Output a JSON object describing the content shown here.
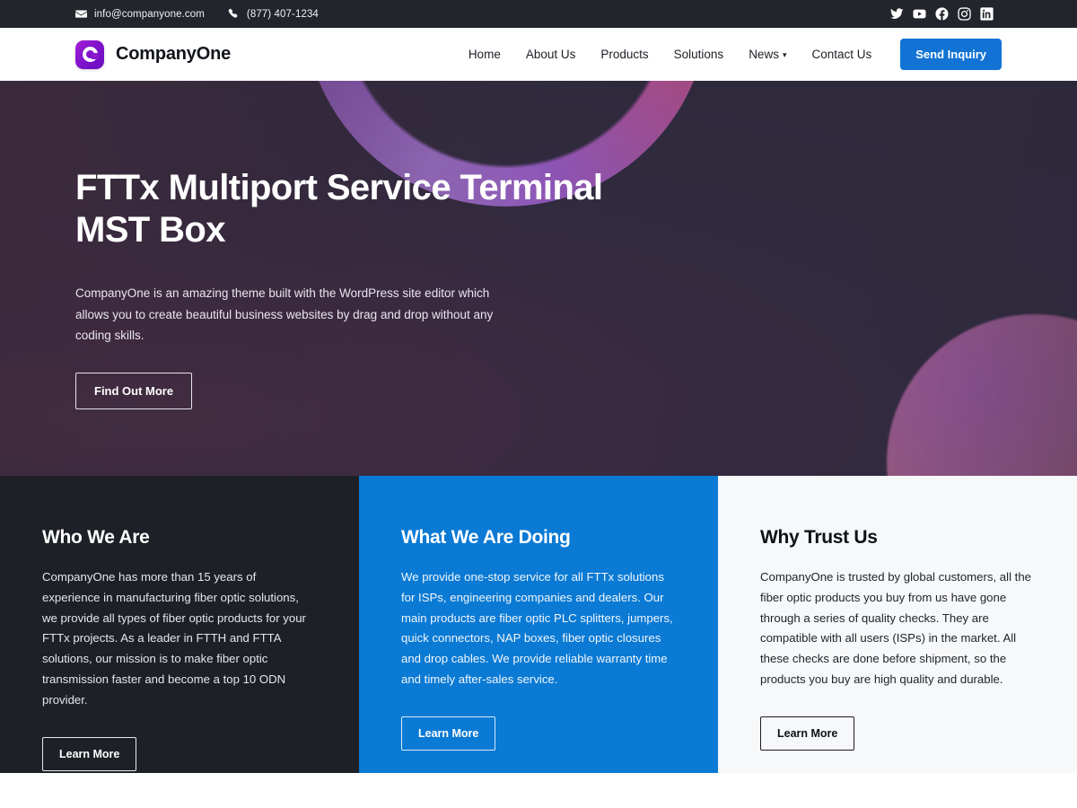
{
  "topbar": {
    "email": "info@companyone.com",
    "phone": "(877) 407-1234",
    "email_icon": "envelope-icon",
    "phone_icon": "phone-icon",
    "socials": [
      {
        "name": "twitter-icon",
        "label": "Twitter"
      },
      {
        "name": "youtube-icon",
        "label": "YouTube"
      },
      {
        "name": "facebook-icon",
        "label": "Facebook"
      },
      {
        "name": "instagram-icon",
        "label": "Instagram"
      },
      {
        "name": "linkedin-icon",
        "label": "LinkedIn"
      }
    ],
    "background": "#22252c"
  },
  "header": {
    "brand": "CompanyOne",
    "logo_icon": "companyone-logo-icon",
    "nav": [
      {
        "label": "Home",
        "has_dropdown": false
      },
      {
        "label": "About Us",
        "has_dropdown": false
      },
      {
        "label": "Products",
        "has_dropdown": false
      },
      {
        "label": "Solutions",
        "has_dropdown": false
      },
      {
        "label": "News",
        "has_dropdown": true
      },
      {
        "label": "Contact Us",
        "has_dropdown": false
      }
    ],
    "cta_label": "Send Inquiry",
    "cta_color": "#1273d4"
  },
  "hero": {
    "title": "FTTx Multiport Service Terminal MST Box",
    "description": "CompanyOne is an amazing theme built with the WordPress site editor which allows you to create beautiful business websites by drag and drop without any coding skills.",
    "button_label": "Find Out More",
    "background_colors": [
      "#3d2b42",
      "#2e2a3c",
      "#e08a4c",
      "#a468d8",
      "#c96fae"
    ]
  },
  "columns": [
    {
      "title": "Who We Are",
      "text": "CompanyOne has more than 15 years of experience in manufacturing fiber optic solutions, we provide all types of fiber optic products for your FTTx projects. As a leader in FTTH and FTTA solutions, our mission is to make fiber optic transmission faster and become a top 10 ODN provider.",
      "button_label": "Learn More",
      "background": "#1d2026"
    },
    {
      "title": "What We Are Doing",
      "text": "We provide one-stop service for all FTTx solutions for ISPs, engineering companies and dealers. Our main products are fiber optic PLC splitters, jumpers, quick connectors, NAP boxes, fiber optic closures and drop cables. We provide reliable warranty time and timely after-sales service.",
      "button_label": "Learn More",
      "background": "#0a7ad4"
    },
    {
      "title": "Why Trust Us",
      "text": "CompanyOne is trusted by global customers, all the fiber optic products you buy from us have gone through a series of quality checks. They are compatible with all users (ISPs) in the market. All these checks are done before shipment, so the products you buy are high quality and durable.",
      "button_label": "Learn More",
      "background": "#f7f8f9"
    }
  ]
}
